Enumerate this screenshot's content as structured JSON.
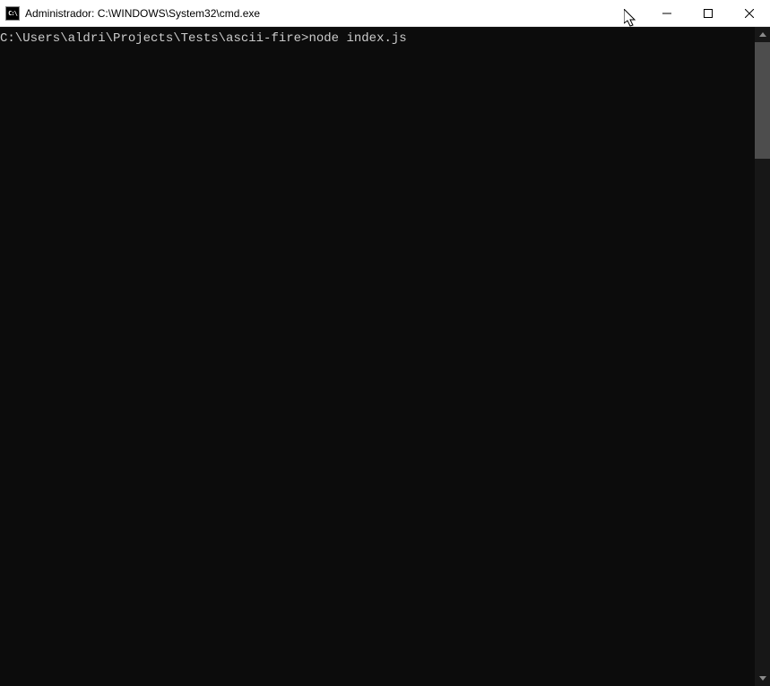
{
  "titlebar": {
    "icon_label": "C:\\",
    "title": "Administrador: C:\\WINDOWS\\System32\\cmd.exe"
  },
  "terminal": {
    "prompt": "C:\\Users\\aldri\\Projects\\Tests\\ascii-fire>",
    "command": "node index.js"
  }
}
